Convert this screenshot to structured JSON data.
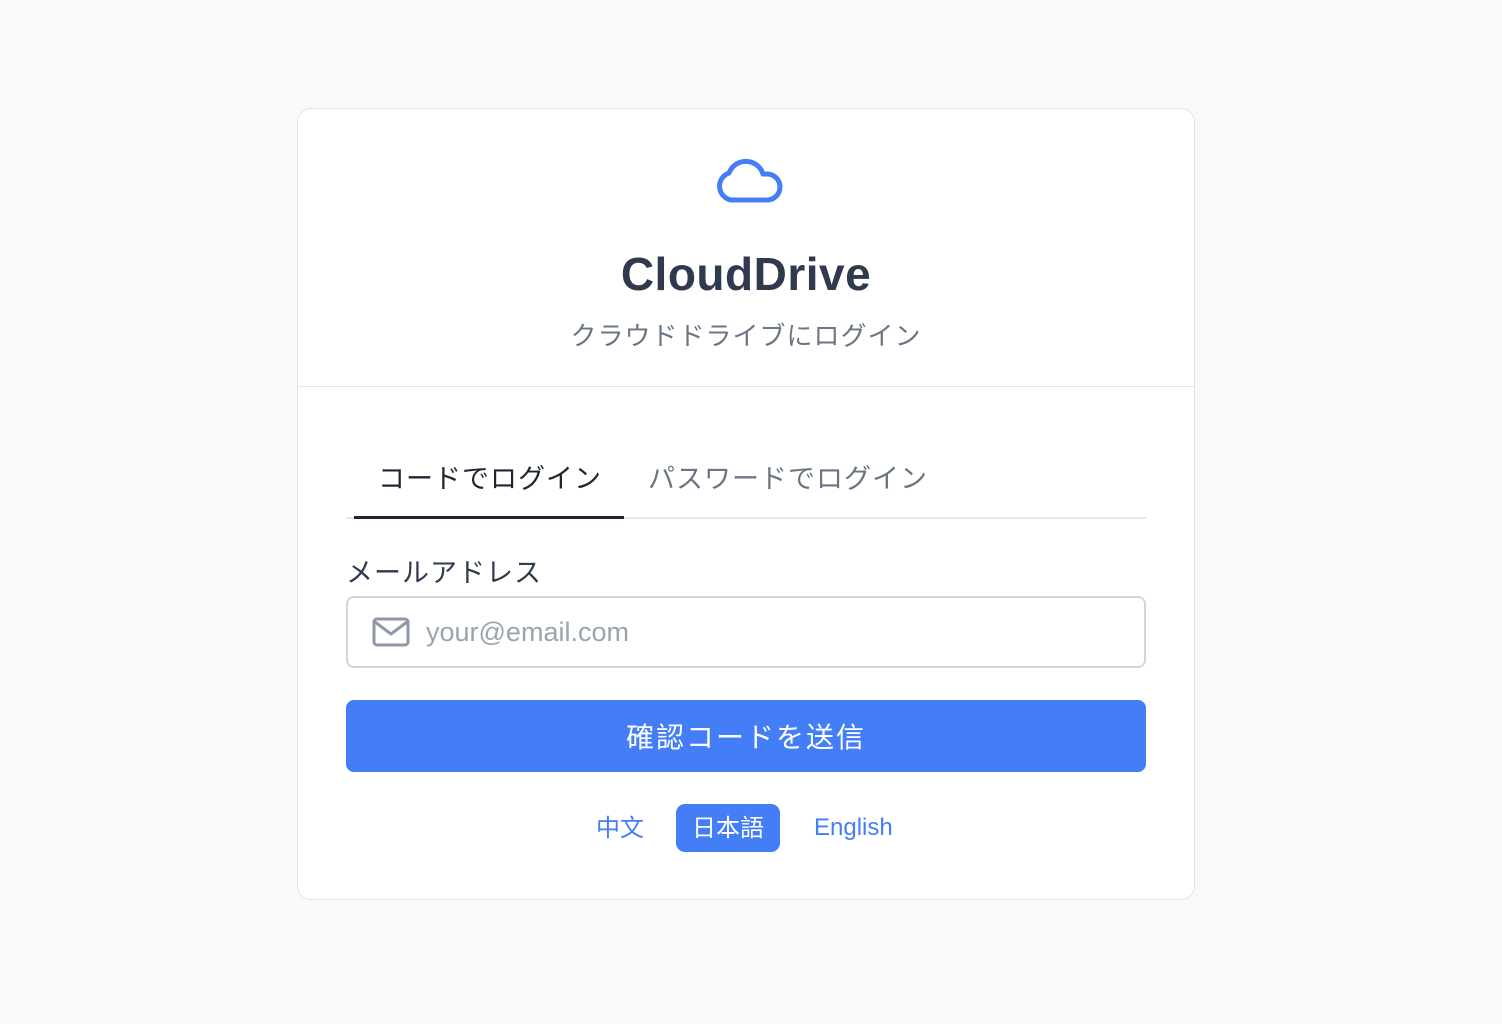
{
  "colors": {
    "accent": "#437ef7",
    "title": "#2f3a4e",
    "muted": "#6b7585",
    "background": "#f8f9fb"
  },
  "header": {
    "logo_icon": "cloud-icon",
    "title": "CloudDrive",
    "subtitle": "クラウドドライブにログイン"
  },
  "tabs": [
    {
      "label": "コードでログイン",
      "active": true
    },
    {
      "label": "パスワードでログイン",
      "active": false
    }
  ],
  "form": {
    "email_label": "メールアドレス",
    "email_icon": "mail-icon",
    "email_value": "",
    "email_placeholder": "your@email.com",
    "submit_label": "確認コードを送信"
  },
  "languages": [
    {
      "label": "中文",
      "selected": false
    },
    {
      "label": "日本語",
      "selected": true
    },
    {
      "label": "English",
      "selected": false
    }
  ]
}
